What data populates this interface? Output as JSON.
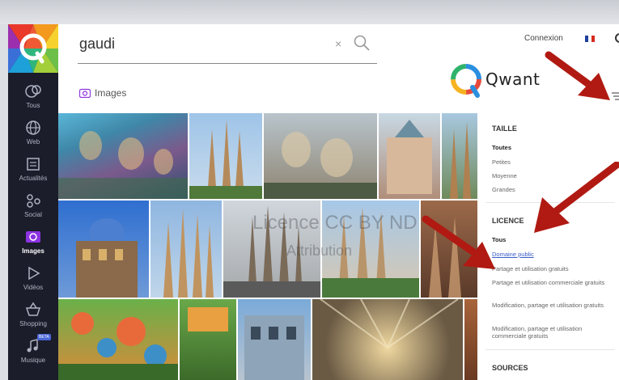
{
  "search": {
    "value": "gaudi",
    "clear_glyph": "×"
  },
  "header": {
    "connexion": "Connexion",
    "brand": "Qwant"
  },
  "vertical": {
    "label": "Images"
  },
  "sidebar": {
    "items": [
      {
        "label": "Tous",
        "icon": "globe-people-icon"
      },
      {
        "label": "Web",
        "icon": "globe-icon"
      },
      {
        "label": "Actualités",
        "icon": "news-icon"
      },
      {
        "label": "Social",
        "icon": "social-icon"
      },
      {
        "label": "Images",
        "icon": "camera-icon",
        "active": true
      },
      {
        "label": "Vidéos",
        "icon": "play-icon"
      },
      {
        "label": "Shopping",
        "icon": "basket-icon"
      },
      {
        "label": "Musique",
        "icon": "music-icon",
        "badge": "BETA"
      }
    ]
  },
  "filters": {
    "taille": {
      "title": "TAILLE",
      "options": [
        "Toutes",
        "Petites",
        "Moyenne",
        "Grandes"
      ]
    },
    "licence": {
      "title": "LICENCE",
      "options": [
        "Tous",
        "Domaine public",
        "Partage et utilisation gratuits",
        "Partage et utilisation commerciale gratuits",
        "Modification, partage et utilisation gratuits",
        "Modification, partage et utilisation commerciale gratuits"
      ]
    },
    "sources": {
      "title": "SOURCES"
    }
  },
  "overlay": {
    "watermark_line1": "Licence CC BY ND",
    "watermark_line2": "Attribution"
  },
  "colors": {
    "accent": "#8c33e0",
    "sidebar_bg": "#1b1d2a",
    "arrow": "#b01a12",
    "link": "#3a5bc7"
  }
}
